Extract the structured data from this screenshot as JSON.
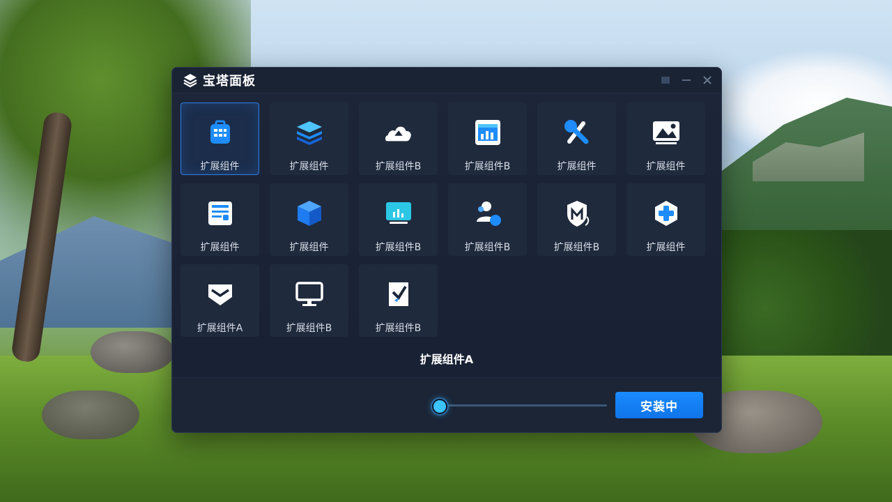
{
  "app": {
    "title": "宝塔面板",
    "controls": {
      "icons": [
        "restore-icon",
        "minimize-icon",
        "close-icon"
      ]
    }
  },
  "tiles": [
    {
      "label": "扩展组件",
      "icon": "toolbox-icon",
      "selected": true
    },
    {
      "label": "扩展组件",
      "icon": "layers-icon"
    },
    {
      "label": "扩展组件B",
      "icon": "cloud-icon"
    },
    {
      "label": "扩展组件B",
      "icon": "dashboard-chart-icon"
    },
    {
      "label": "扩展组件",
      "icon": "tools-icon"
    },
    {
      "label": "扩展组件",
      "icon": "image-gallery-icon"
    },
    {
      "label": "扩展组件",
      "icon": "form-document-icon"
    },
    {
      "label": "扩展组件",
      "icon": "cube-icon"
    },
    {
      "label": "扩展组件B",
      "icon": "monitor-stats-icon"
    },
    {
      "label": "扩展组件B",
      "icon": "users-icon"
    },
    {
      "label": "扩展组件B",
      "icon": "shield-icon"
    },
    {
      "label": "扩展组件",
      "icon": "medical-plus-icon"
    },
    {
      "label": "扩展组件A",
      "icon": "badge-chevron-icon"
    },
    {
      "label": "扩展组件B",
      "icon": "desktop-monitor-icon"
    },
    {
      "label": "扩展组件B",
      "icon": "edit-brush-icon"
    }
  ],
  "status": {
    "current_item": "扩展组件A"
  },
  "progress": {
    "value": 0.0
  },
  "footer": {
    "install_label": "安装中"
  },
  "colors": {
    "accent": "#1a8bff",
    "window_bg": "#1c2638",
    "tile_bg": "#1f2a3d"
  }
}
